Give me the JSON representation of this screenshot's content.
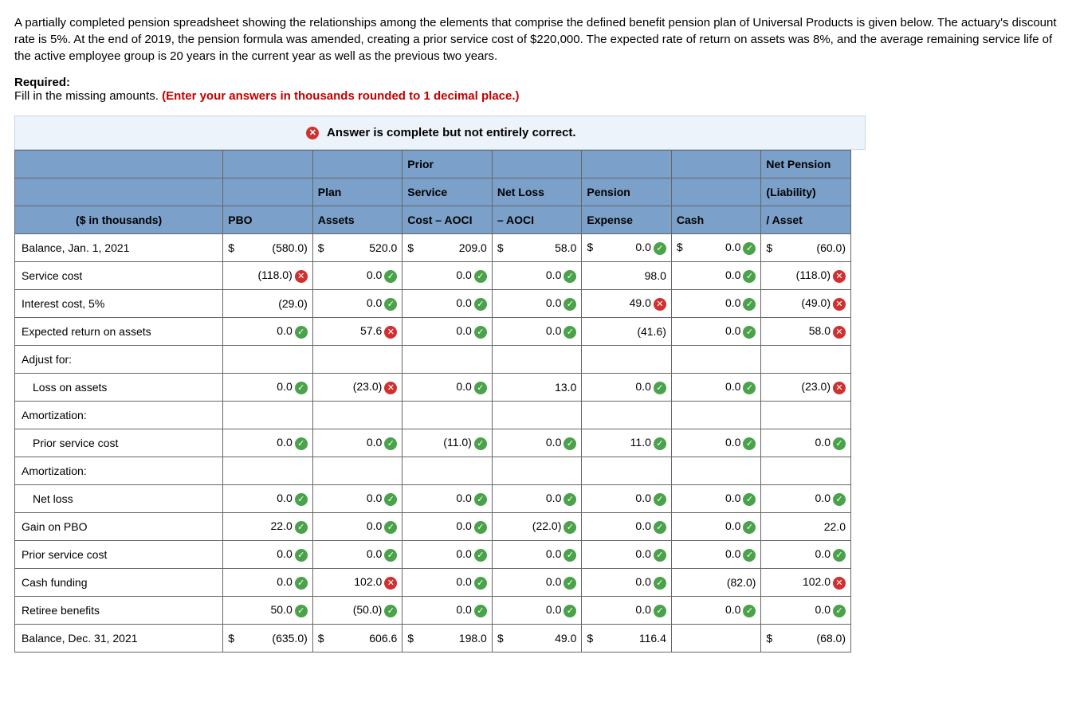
{
  "intro": "A partially completed pension spreadsheet showing the relationships among the elements that comprise the defined benefit pension plan of Universal Products is given below. The actuary's discount rate is 5%. At the end of 2019, the pension formula was amended, creating a prior service cost of $220,000. The expected rate of return on assets was 8%, and the average remaining service life of the active employee group is 20 years in the current year as well as the previous two years.",
  "required_label": "Required:",
  "required_text": "Fill in the missing amounts. ",
  "required_hint": "(Enter your answers in thousands rounded to 1 decimal place.)",
  "banner": "Answer is complete but not entirely correct.",
  "headers": {
    "row1": [
      "",
      "",
      "",
      "Prior",
      "",
      "",
      "",
      "Net Pension"
    ],
    "row2": [
      "",
      "",
      "Plan",
      "Service",
      "Net Loss",
      "Pension",
      "",
      "(Liability)"
    ],
    "row3": [
      "($ in thousands)",
      "PBO",
      "Assets",
      "Cost – AOCI",
      "– AOCI",
      "Expense",
      "Cash",
      "/ Asset"
    ]
  },
  "rows": [
    {
      "label": "Balance, Jan. 1, 2021",
      "indent": false,
      "cells": [
        {
          "sym": "$",
          "val": "(580.0)"
        },
        {
          "sym": "$",
          "val": "520.0"
        },
        {
          "sym": "$",
          "val": "209.0"
        },
        {
          "sym": "$",
          "val": "58.0"
        },
        {
          "sym": "$",
          "val": "0.0",
          "mark": "ok"
        },
        {
          "sym": "$",
          "val": "0.0",
          "mark": "ok"
        },
        {
          "sym": "$",
          "val": "(60.0)"
        }
      ]
    },
    {
      "label": "Service cost",
      "indent": false,
      "cells": [
        {
          "val": "(118.0)",
          "mark": "no"
        },
        {
          "val": "0.0",
          "mark": "ok"
        },
        {
          "val": "0.0",
          "mark": "ok"
        },
        {
          "val": "0.0",
          "mark": "ok"
        },
        {
          "val": "98.0"
        },
        {
          "val": "0.0",
          "mark": "ok"
        },
        {
          "val": "(118.0)",
          "mark": "no"
        }
      ]
    },
    {
      "label": "Interest cost, 5%",
      "indent": false,
      "cells": [
        {
          "val": "(29.0)"
        },
        {
          "val": "0.0",
          "mark": "ok"
        },
        {
          "val": "0.0",
          "mark": "ok"
        },
        {
          "val": "0.0",
          "mark": "ok"
        },
        {
          "val": "49.0",
          "mark": "no"
        },
        {
          "val": "0.0",
          "mark": "ok"
        },
        {
          "val": "(49.0)",
          "mark": "no"
        }
      ]
    },
    {
      "label": "Expected return on assets",
      "indent": false,
      "cells": [
        {
          "val": "0.0",
          "mark": "ok"
        },
        {
          "val": "57.6",
          "mark": "no"
        },
        {
          "val": "0.0",
          "mark": "ok"
        },
        {
          "val": "0.0",
          "mark": "ok"
        },
        {
          "val": "(41.6)"
        },
        {
          "val": "0.0",
          "mark": "ok"
        },
        {
          "val": "58.0",
          "mark": "no"
        }
      ]
    },
    {
      "label": "Adjust for:",
      "indent": false,
      "cells": [
        {
          "val": ""
        },
        {
          "val": ""
        },
        {
          "val": ""
        },
        {
          "val": ""
        },
        {
          "val": ""
        },
        {
          "val": ""
        },
        {
          "val": ""
        }
      ]
    },
    {
      "label": "Loss on assets",
      "indent": true,
      "cells": [
        {
          "val": "0.0",
          "mark": "ok"
        },
        {
          "val": "(23.0)",
          "mark": "no"
        },
        {
          "val": "0.0",
          "mark": "ok"
        },
        {
          "val": "13.0"
        },
        {
          "val": "0.0",
          "mark": "ok"
        },
        {
          "val": "0.0",
          "mark": "ok"
        },
        {
          "val": "(23.0)",
          "mark": "no"
        }
      ]
    },
    {
      "label": "Amortization:",
      "indent": false,
      "cells": [
        {
          "val": ""
        },
        {
          "val": ""
        },
        {
          "val": ""
        },
        {
          "val": ""
        },
        {
          "val": ""
        },
        {
          "val": ""
        },
        {
          "val": ""
        }
      ]
    },
    {
      "label": "Prior service cost",
      "indent": true,
      "cells": [
        {
          "val": "0.0",
          "mark": "ok"
        },
        {
          "val": "0.0",
          "mark": "ok"
        },
        {
          "val": "(11.0)",
          "mark": "ok"
        },
        {
          "val": "0.0",
          "mark": "ok"
        },
        {
          "val": "11.0",
          "mark": "ok"
        },
        {
          "val": "0.0",
          "mark": "ok"
        },
        {
          "val": "0.0",
          "mark": "ok"
        }
      ]
    },
    {
      "label": "Amortization:",
      "indent": false,
      "cells": [
        {
          "val": ""
        },
        {
          "val": ""
        },
        {
          "val": ""
        },
        {
          "val": ""
        },
        {
          "val": ""
        },
        {
          "val": ""
        },
        {
          "val": ""
        }
      ]
    },
    {
      "label": "Net loss",
      "indent": true,
      "cells": [
        {
          "val": "0.0",
          "mark": "ok"
        },
        {
          "val": "0.0",
          "mark": "ok"
        },
        {
          "val": "0.0",
          "mark": "ok"
        },
        {
          "val": "0.0",
          "mark": "ok"
        },
        {
          "val": "0.0",
          "mark": "ok"
        },
        {
          "val": "0.0",
          "mark": "ok"
        },
        {
          "val": "0.0",
          "mark": "ok"
        }
      ]
    },
    {
      "label": "Gain on PBO",
      "indent": false,
      "cells": [
        {
          "val": "22.0",
          "mark": "ok"
        },
        {
          "val": "0.0",
          "mark": "ok"
        },
        {
          "val": "0.0",
          "mark": "ok"
        },
        {
          "val": "(22.0)",
          "mark": "ok"
        },
        {
          "val": "0.0",
          "mark": "ok"
        },
        {
          "val": "0.0",
          "mark": "ok"
        },
        {
          "val": "22.0"
        }
      ]
    },
    {
      "label": "Prior service cost",
      "indent": false,
      "cells": [
        {
          "val": "0.0",
          "mark": "ok"
        },
        {
          "val": "0.0",
          "mark": "ok"
        },
        {
          "val": "0.0",
          "mark": "ok"
        },
        {
          "val": "0.0",
          "mark": "ok"
        },
        {
          "val": "0.0",
          "mark": "ok"
        },
        {
          "val": "0.0",
          "mark": "ok"
        },
        {
          "val": "0.0",
          "mark": "ok"
        }
      ]
    },
    {
      "label": "Cash funding",
      "indent": false,
      "cells": [
        {
          "val": "0.0",
          "mark": "ok"
        },
        {
          "val": "102.0",
          "mark": "no"
        },
        {
          "val": "0.0",
          "mark": "ok"
        },
        {
          "val": "0.0",
          "mark": "ok"
        },
        {
          "val": "0.0",
          "mark": "ok"
        },
        {
          "val": "(82.0)"
        },
        {
          "val": "102.0",
          "mark": "no"
        }
      ]
    },
    {
      "label": "Retiree benefits",
      "indent": false,
      "cells": [
        {
          "val": "50.0",
          "mark": "ok"
        },
        {
          "val": "(50.0)",
          "mark": "ok"
        },
        {
          "val": "0.0",
          "mark": "ok"
        },
        {
          "val": "0.0",
          "mark": "ok"
        },
        {
          "val": "0.0",
          "mark": "ok"
        },
        {
          "val": "0.0",
          "mark": "ok"
        },
        {
          "val": "0.0",
          "mark": "ok"
        }
      ]
    },
    {
      "label": "Balance, Dec. 31, 2021",
      "indent": false,
      "cells": [
        {
          "sym": "$",
          "val": "(635.0)"
        },
        {
          "sym": "$",
          "val": "606.6"
        },
        {
          "sym": "$",
          "val": "198.0"
        },
        {
          "sym": "$",
          "val": "49.0"
        },
        {
          "sym": "$",
          "val": "116.4"
        },
        {
          "val": ""
        },
        {
          "sym": "$",
          "val": "(68.0)"
        }
      ]
    }
  ]
}
